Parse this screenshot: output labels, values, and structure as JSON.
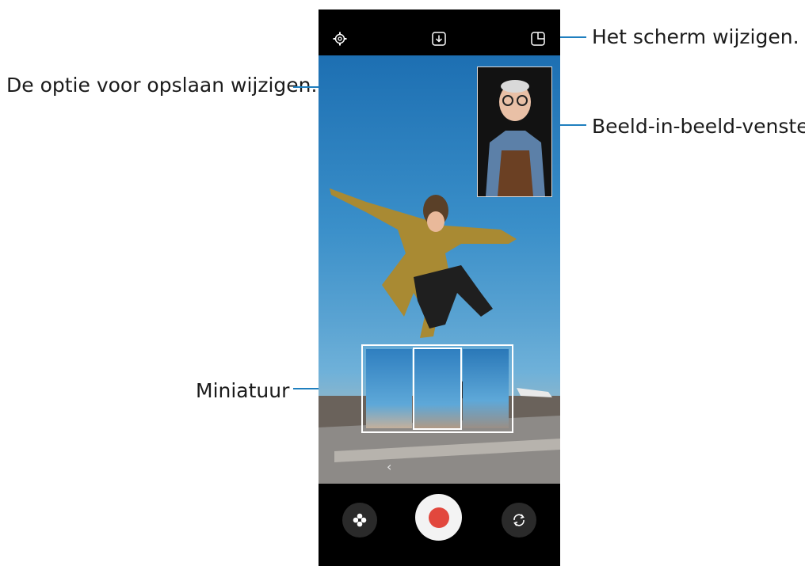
{
  "callouts": {
    "change_save": "De optie voor opslaan wijzigen.",
    "change_screen": "Het scherm wijzigen.",
    "pip_window": "Beeld-in-beeld-venster",
    "thumbnail": "Miniatuur"
  },
  "icons": {
    "settings": "gear-icon",
    "save_option": "download-icon",
    "screen_layout": "layout-icon",
    "effects": "flower-icon",
    "record": "record-button",
    "switch_camera": "rotate-icon",
    "back": "chevron-left-icon"
  },
  "colors": {
    "callout_line": "#1f7fbf",
    "record_dot": "#e2473d"
  },
  "viewfinder": {
    "chevron": "‹"
  }
}
